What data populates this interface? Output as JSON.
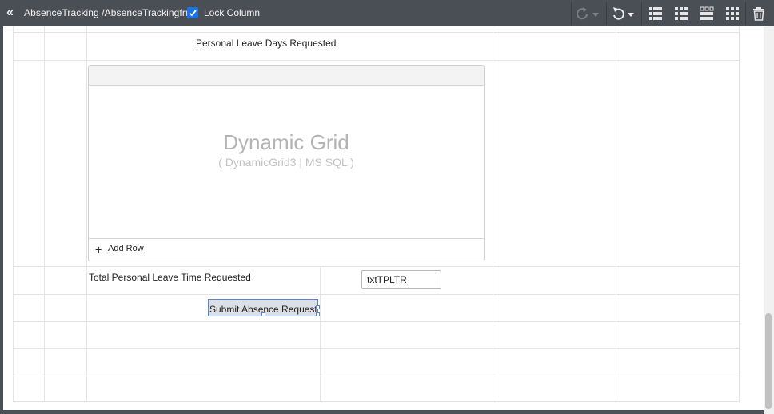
{
  "toolbar": {
    "breadcrumb": "AbsenceTracking /AbsenceTrackingfrm",
    "lock_column_label": "Lock Column",
    "lock_column_checked": true,
    "icons": {
      "collapse": "double-chevron-left-icon",
      "redo": "redo-icon",
      "undo": "undo-icon",
      "layouts": [
        "grid-layout-1-icon",
        "grid-layout-2-icon",
        "grid-layout-3-icon",
        "grid-layout-4-icon"
      ],
      "delete": "trash-icon"
    },
    "colors": {
      "background": "#4a4f55",
      "checkbox": "#1a73e8"
    }
  },
  "form": {
    "personal_leave_days_label": "Personal Leave Days Requested",
    "dynamic_grid": {
      "title": "Dynamic Grid",
      "subtitle": "( DynamicGrid3 | MS SQL )",
      "add_row_label": "Add Row"
    },
    "total_personal_leave_label": "Total Personal Leave Time Requested",
    "txt_field_value": "txtTPLTR",
    "submit_label": "Submit Absence Request"
  }
}
